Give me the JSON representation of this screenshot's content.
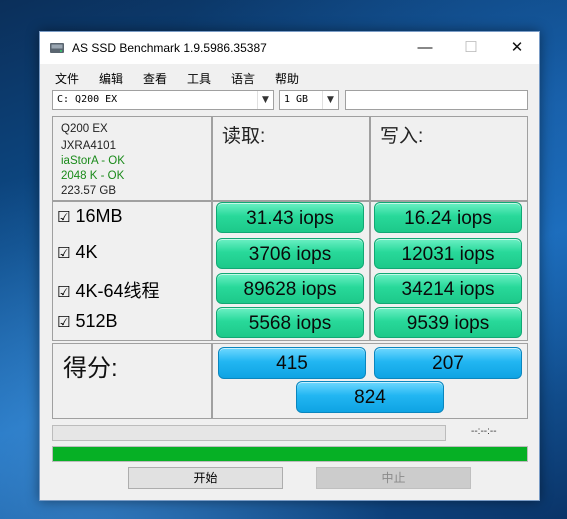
{
  "window": {
    "title": "AS SSD Benchmark 1.9.5986.35387",
    "controls": {
      "minimize": "—",
      "maximize": "☐",
      "close": "✕"
    }
  },
  "menu": [
    "文件",
    "编辑",
    "查看",
    "工具",
    "语言",
    "帮助"
  ],
  "drive_select": {
    "value": "C: Q200 EX"
  },
  "size_select": {
    "value": "1 GB"
  },
  "name_field": {
    "value": ""
  },
  "drive_info": {
    "model": "Q200 EX",
    "firmware": "JXRA4101",
    "driver": "iaStorA - OK",
    "alignment": "2048 K - OK",
    "capacity": "223.57 GB"
  },
  "headers": {
    "read": "读取:",
    "write": "写入:"
  },
  "tests": [
    {
      "checkbox": "☑",
      "name": "16MB",
      "read": "31.43 iops",
      "write": "16.24 iops"
    },
    {
      "checkbox": "☑",
      "name": "4K",
      "read": "3706 iops",
      "write": "12031 iops"
    },
    {
      "checkbox": "☑",
      "name": "4K-64线程",
      "read": "89628 iops",
      "write": "34214 iops"
    },
    {
      "checkbox": "☑",
      "name": "512B",
      "read": "5568 iops",
      "write": "9539 iops"
    }
  ],
  "score": {
    "label": "得分:",
    "read": "415",
    "write": "207",
    "total": "824"
  },
  "progress": {
    "time": "--:--:--",
    "top_fraction": 0.0,
    "bottom_fraction": 1.0
  },
  "buttons": {
    "start": "开始",
    "abort": "中止"
  },
  "colors": {
    "result_green": "#1dc98a",
    "score_blue": "#0ea3e3",
    "progress_green": "#06b025"
  },
  "icons": {
    "app": "drive-icon"
  }
}
